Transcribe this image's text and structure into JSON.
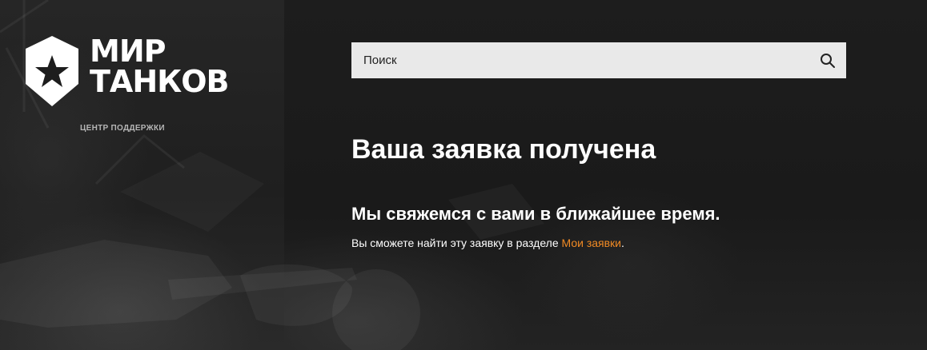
{
  "brand": {
    "logo_line1": "МИР",
    "logo_line2": "ТАНКОВ",
    "support_label": "ЦЕНТР ПОДДЕРЖКИ"
  },
  "search": {
    "placeholder": "Поиск",
    "icon": "search-icon"
  },
  "main": {
    "title": "Ваша заявка получена",
    "subtitle": "Мы свяжемся с вами в ближайшее время.",
    "info_prefix": "Вы сможете найти эту заявку в разделе ",
    "info_link": "Мои заявки",
    "info_suffix": "."
  },
  "colors": {
    "link": "#f08a24",
    "background": "#1e1e1e",
    "search_bg": "#e9e9e9"
  }
}
